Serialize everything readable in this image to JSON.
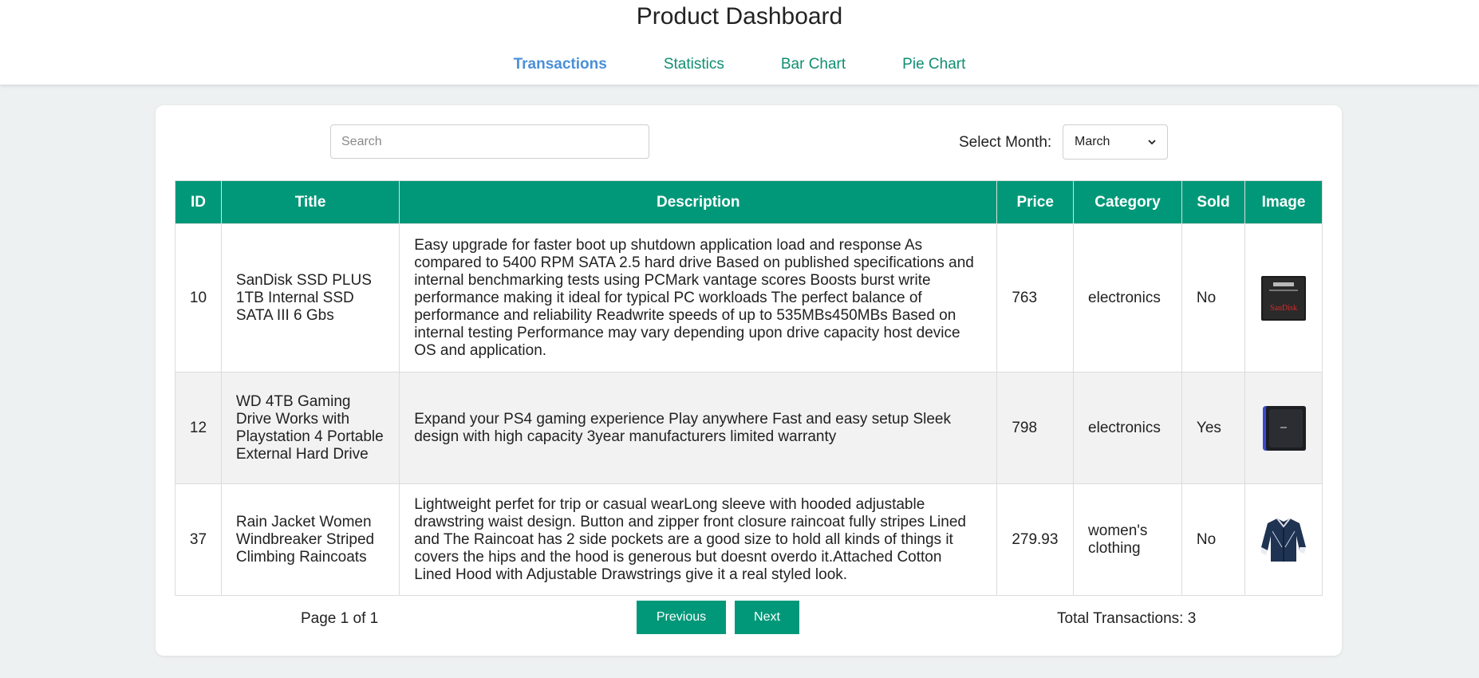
{
  "header": {
    "title": "Product Dashboard",
    "tabs": [
      {
        "label": "Transactions",
        "active": true
      },
      {
        "label": "Statistics",
        "active": false
      },
      {
        "label": "Bar Chart",
        "active": false
      },
      {
        "label": "Pie Chart",
        "active": false
      }
    ]
  },
  "filters": {
    "search_placeholder": "Search",
    "search_value": "",
    "month_label": "Select Month:",
    "month_value": "March"
  },
  "table": {
    "columns": [
      "ID",
      "Title",
      "Description",
      "Price",
      "Category",
      "Sold",
      "Image"
    ],
    "rows": [
      {
        "id": "10",
        "title": "SanDisk SSD PLUS 1TB Internal SSD SATA III 6 Gbs",
        "description": "Easy upgrade for faster boot up shutdown application load and response As compared to 5400 RPM SATA 2.5 hard drive Based on published specifications and internal benchmarking tests using PCMark vantage scores Boosts burst write performance making it ideal for typical PC workloads The perfect balance of performance and reliability Readwrite speeds of up to 535MBs450MBs Based on internal testing Performance may vary depending upon drive capacity host device OS and application.",
        "price": "763",
        "category": "electronics",
        "sold": "No",
        "image_icon": "ssd-product-image",
        "image_text": "SanDisk"
      },
      {
        "id": "12",
        "title": "WD 4TB Gaming Drive Works with Playstation 4 Portable External Hard Drive",
        "description": "Expand your PS4 gaming experience Play anywhere Fast and easy setup Sleek design with high capacity 3year manufacturers limited warranty",
        "price": "798",
        "category": "electronics",
        "sold": "Yes",
        "image_icon": "hard-drive-product-image"
      },
      {
        "id": "37",
        "title": "Rain Jacket Women Windbreaker Striped Climbing Raincoats",
        "description": "Lightweight perfet for trip or casual wearLong sleeve with hooded adjustable drawstring waist design. Button and zipper front closure raincoat fully stripes Lined and The Raincoat has 2 side pockets are a good size to hold all kinds of things it covers the hips and the hood is generous but doesnt overdo it.Attached Cotton Lined Hood with Adjustable Drawstrings give it a real styled look.",
        "price": "279.93",
        "category": "women's clothing",
        "sold": "No",
        "image_icon": "jacket-product-image"
      }
    ]
  },
  "pagination": {
    "page_text": "Page 1 of 1",
    "prev_label": "Previous",
    "next_label": "Next",
    "total_text": "Total Transactions: 3"
  },
  "colors": {
    "accent": "#009879",
    "active_tab": "#4a8fd8",
    "tab": "#0f8f72"
  }
}
